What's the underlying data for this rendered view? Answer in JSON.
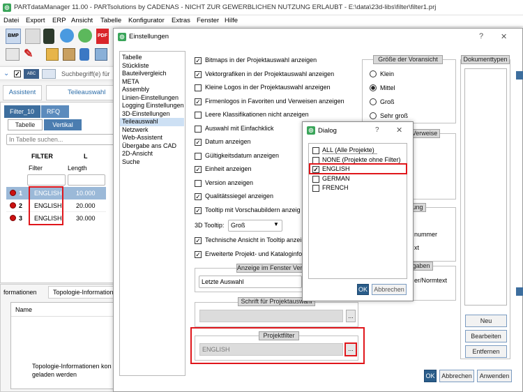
{
  "app": {
    "title": "PARTdataManager 11.00 - PARTsolutions by CADENAS - NICHT ZUR GEWERBLICHEN NUTZUNG ERLAUBT - E:\\data\\23d-libs\\filter\\filter1.prj"
  },
  "menu": [
    "Datei",
    "Export",
    "ERP",
    "Ansicht",
    "Tabelle",
    "Konfigurator",
    "Extras",
    "Fenster",
    "Hilfe"
  ],
  "toolbar": {
    "bmp": "BMP",
    "pdf": "PDF",
    "abc": "ABC",
    "search_placeholder": "Suchbegriff(e) für"
  },
  "tabs_top": [
    "Assistent",
    "Teileauswahl"
  ],
  "left_tabs": [
    "Filter_10",
    "RFQ"
  ],
  "left_subtabs": [
    "Tabelle",
    "Vertikal"
  ],
  "table_search_placeholder": "In Tabelle suchen...",
  "table": {
    "col_headers": [
      "FILTER",
      "L"
    ],
    "col_sub": [
      "Filter",
      "Length"
    ],
    "rows": [
      {
        "n": "1",
        "filter": "ENGLISH",
        "length": "10.000"
      },
      {
        "n": "2",
        "filter": "ENGLISH",
        "length": "20.000"
      },
      {
        "n": "3",
        "filter": "ENGLISH",
        "length": "30.000"
      }
    ]
  },
  "bottom_tabs": [
    "formationen",
    "Topologie-Informationen"
  ],
  "bottom_list_header": "Name",
  "bottom_message": "Topologie-Informationen kon\ngeladen werden",
  "settings": {
    "title": "Einstellungen",
    "help": "?",
    "close": "✕",
    "nav": [
      "Tabelle",
      "Stückliste",
      "Bauteilvergleich",
      "META",
      "Assembly",
      "Linien-Einstellungen",
      "Logging Einstellungen",
      "3D-Einstellungen",
      "Teileauswahl",
      "Netzwerk",
      "Web-Assistent",
      "Übergabe ans CAD",
      "2D-Ansicht",
      "Suche"
    ],
    "selected_nav": "Teileauswahl",
    "checkboxes": [
      {
        "label": "Bitmaps in der Projektauswahl anzeigen",
        "checked": true
      },
      {
        "label": "Vektorgrafiken in der Projektauswahl anzeigen",
        "checked": true
      },
      {
        "label": "Kleine Logos in der Projektauswahl anzeigen",
        "checked": false
      },
      {
        "label": "Firmenlogos in Favoriten und Verweisen anzeigen",
        "checked": true
      },
      {
        "label": "Leere Klassifikationen nicht anzeigen",
        "checked": false
      },
      {
        "label": "Auswahl mit Einfachklick",
        "checked": false
      },
      {
        "label": "Datum anzeigen",
        "checked": true
      },
      {
        "label": "Gültigkeitsdatum anzeigen",
        "checked": false
      },
      {
        "label": "Einheit anzeigen",
        "checked": true
      },
      {
        "label": "Version anzeigen",
        "checked": false
      },
      {
        "label": "Qualitätssiegel anzeigen",
        "checked": true
      },
      {
        "label": "Tooltip mit Vorschaubildern anzeig",
        "checked": true
      }
    ],
    "tooltip_label": "3D Tooltip:",
    "tooltip_value": "Groß",
    "checkboxes2": [
      {
        "label": "Technische Ansicht in Tooltip anzei",
        "checked": true
      },
      {
        "label": "Erweiterte Projekt- und Kataloginfo",
        "checked": true
      }
    ],
    "anzeige_title": "Anzeige im Fenster Ver",
    "anzeige_value": "Letzte Auswahl",
    "schrift_title": "Schrift für Projektauswahl",
    "projektfilter_title": "Projektfilter",
    "projektfilter_value": "ENGLISH",
    "dots": "...",
    "vorschau_title": "Größe der Voransicht",
    "vorschau_options": [
      {
        "label": "Klein",
        "selected": false
      },
      {
        "label": "Mittel",
        "selected": true
      },
      {
        "label": "Groß",
        "selected": false
      },
      {
        "label": "Sehr groß",
        "selected": false
      }
    ],
    "partial_texts": {
      "verweise": "Verweise",
      "ung": "ung",
      "nummer": "nummer",
      "xt": "xt",
      "gaben": "gaben",
      "normtext": "er/Normtext"
    },
    "doc_title": "Dokumenttypen",
    "doc_buttons": [
      "Neu",
      "Bearbeiten",
      "Entfernen"
    ],
    "footer_buttons": [
      "OK",
      "Abbrechen",
      "Anwenden"
    ]
  },
  "dialog": {
    "title": "Dialog",
    "help": "?",
    "close": "✕",
    "items": [
      {
        "label": "ALL (Alle Projekte)",
        "checked": false
      },
      {
        "label": "NONE (Projekte ohne Filter)",
        "checked": false
      },
      {
        "label": "ENGLISH",
        "checked": true
      },
      {
        "label": "GERMAN",
        "checked": false
      },
      {
        "label": "FRENCH",
        "checked": false
      }
    ],
    "ok": "OK",
    "cancel": "Abbrechen"
  },
  "colors": {
    "highlight_red": "#e0161b",
    "ok_blue": "#2a5d8a",
    "app_green": "#3aa55a"
  }
}
